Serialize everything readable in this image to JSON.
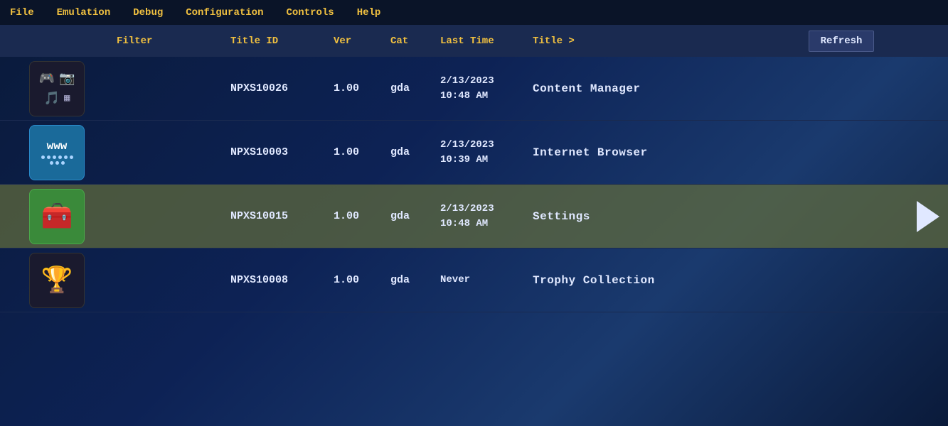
{
  "menubar": {
    "items": [
      {
        "label": "File",
        "id": "file"
      },
      {
        "label": "Emulation",
        "id": "emulation"
      },
      {
        "label": "Debug",
        "id": "debug"
      },
      {
        "label": "Configuration",
        "id": "configuration"
      },
      {
        "label": "Controls",
        "id": "controls"
      },
      {
        "label": "Help",
        "id": "help"
      }
    ]
  },
  "table": {
    "headers": {
      "filter": "Filter",
      "title_id": "Title ID",
      "ver": "Ver",
      "cat": "Cat",
      "last_time": "Last Time",
      "title": "Title >",
      "refresh": "Refresh"
    },
    "rows": [
      {
        "id": "npxs10026",
        "title_id": "NPXS10026",
        "ver": "1.00",
        "cat": "gda",
        "last_time_line1": "2/13/2023",
        "last_time_line2": "10:48 AM",
        "title": "Content Manager",
        "icon_type": "content-manager",
        "selected": false
      },
      {
        "id": "npxs10003",
        "title_id": "NPXS10003",
        "ver": "1.00",
        "cat": "gda",
        "last_time_line1": "2/13/2023",
        "last_time_line2": "10:39 AM",
        "title": "Internet Browser",
        "icon_type": "internet-browser",
        "selected": false
      },
      {
        "id": "npxs10015",
        "title_id": "NPXS10015",
        "ver": "1.00",
        "cat": "gda",
        "last_time_line1": "2/13/2023",
        "last_time_line2": "10:48 AM",
        "title": "Settings",
        "icon_type": "settings",
        "selected": true
      },
      {
        "id": "npxs10008",
        "title_id": "NPXS10008",
        "ver": "1.00",
        "cat": "gda",
        "last_time_line1": "Never",
        "last_time_line2": "",
        "title": "Trophy Collection",
        "icon_type": "trophy",
        "selected": false
      }
    ]
  },
  "colors": {
    "selected_row_bg": "rgba(100,110,60,0.7)",
    "header_bg": "#1a2a50",
    "menu_bg": "#0a1428",
    "accent": "#f0c040"
  }
}
